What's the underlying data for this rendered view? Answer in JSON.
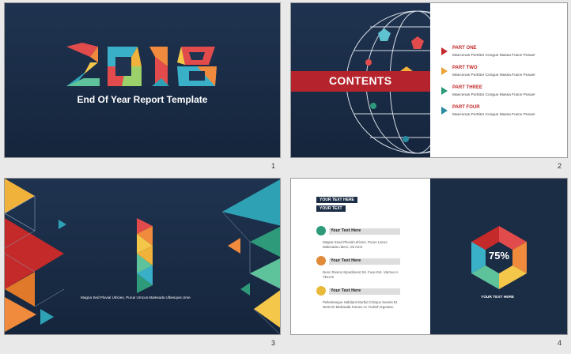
{
  "slides": [
    {
      "number": "1",
      "year": "2018",
      "subtitle": "End Of Year Report Template"
    },
    {
      "number": "2",
      "heading": "CONTENTS",
      "parts": [
        {
          "title": "PART ONE",
          "desc": "Maecenas Porttitor Congue Massa Fusce Posuer",
          "color": "#c42a2a"
        },
        {
          "title": "PART TWO",
          "desc": "Maecenas Porttitor Congue Massa Fusce Posuer",
          "color": "#e9a33a"
        },
        {
          "title": "PART THREE",
          "desc": "Maecenas Porttitor Congue Massa Fusce Posuer",
          "color": "#2e9a7a"
        },
        {
          "title": "PART FOUR",
          "desc": "Maecenas Porttitor Congue Massa Fusce Posuer",
          "color": "#2a8aa0"
        }
      ]
    },
    {
      "number": "3",
      "caption": "Magna Sed Pluvial Ulricies, Purus Urncus Malesada Ulbesquis Urse"
    },
    {
      "number": "4",
      "tags": [
        "YOUR TEXT HERE",
        "YOUR TEXT"
      ],
      "items": [
        {
          "label": "Your Text Here",
          "text": "Magna Sead Pluvial Ulricies. Purus Lacus Malesada Libero, Sit Amit",
          "color": "#2e9a7a"
        },
        {
          "label": "Your Text Here",
          "text": "Nunc Rivera Impediment Sit. Fuse Est. Varmus A TELUS",
          "color": "#e08a3a"
        },
        {
          "label": "Your Text Here",
          "text": "Pellentesque Habitant Morbid Critique Senets Et Netis Et Malesada Fames Ac Turkish Egestas.",
          "color": "#e9b93a"
        }
      ],
      "percent": "75%",
      "hex_label": "YOUR TEXT HERE"
    }
  ],
  "colors": {
    "navy": "#1b2c45",
    "red": "#b5242d",
    "orange": "#e9a33a",
    "teal": "#2e9a7a"
  }
}
